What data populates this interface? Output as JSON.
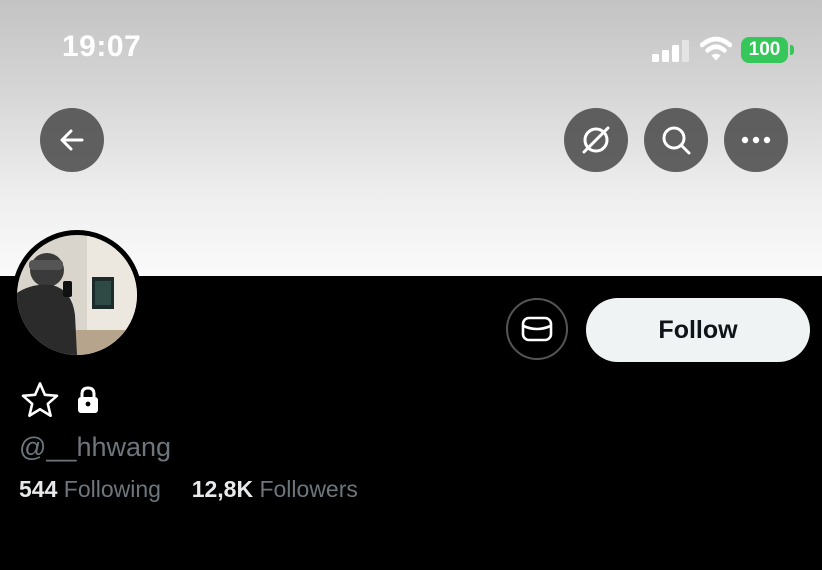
{
  "status_bar": {
    "time": "19:07",
    "battery": "100",
    "colors": {
      "battery": "#35c759"
    }
  },
  "nav": {
    "back_icon": "arrow-left-icon",
    "grok_icon": "grok-slash-icon",
    "search_icon": "search-icon",
    "more_icon": "more-horizontal-icon"
  },
  "profile": {
    "handle": "@__hhwang",
    "following_count": "544",
    "following_label": "Following",
    "followers_count": "12,8K",
    "followers_label": "Followers",
    "follow_label": "Follow",
    "message_icon": "message-icon",
    "favorite_icon": "star-outline-icon",
    "protected_icon": "lock-icon"
  }
}
